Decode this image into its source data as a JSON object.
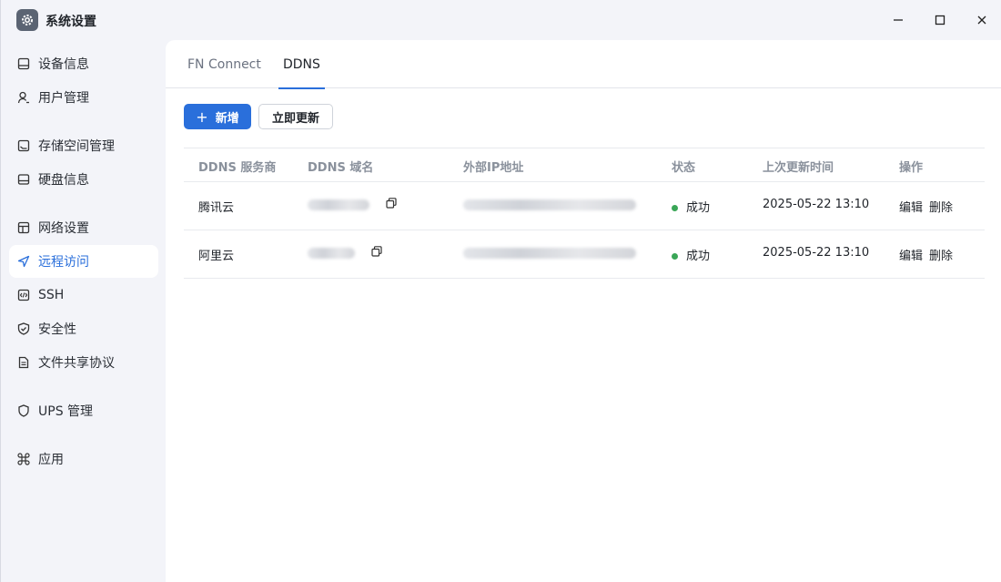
{
  "window": {
    "title": "系统设置",
    "minimize_glyph": "—",
    "maximize_glyph": "□",
    "close_glyph": "✕"
  },
  "sidebar": {
    "items": [
      {
        "label": "设备信息",
        "icon": "device-icon"
      },
      {
        "label": "用户管理",
        "icon": "user-icon"
      },
      {
        "label": "存储空间管理",
        "icon": "storage-icon"
      },
      {
        "label": "硬盘信息",
        "icon": "disk-icon"
      },
      {
        "label": "网络设置",
        "icon": "network-icon"
      },
      {
        "label": "远程访问",
        "icon": "send-icon",
        "active": true
      },
      {
        "label": "SSH",
        "icon": "code-icon"
      },
      {
        "label": "安全性",
        "icon": "shield-check-icon"
      },
      {
        "label": "文件共享协议",
        "icon": "file-icon"
      },
      {
        "label": "UPS 管理",
        "icon": "shield-icon"
      },
      {
        "label": "应用",
        "icon": "command-icon"
      }
    ]
  },
  "tabs": [
    {
      "label": "FN Connect"
    },
    {
      "label": "DDNS",
      "active": true
    }
  ],
  "toolbar": {
    "add_label": "新增",
    "add_glyph": "+",
    "refresh_label": "立即更新"
  },
  "table": {
    "columns": [
      "DDNS 服务商",
      "DDNS 域名",
      "外部IP地址",
      "状态",
      "上次更新时间",
      "操作"
    ],
    "rows": [
      {
        "provider": "腾讯云",
        "status": "成功",
        "updated": "2025-05-22 13:10",
        "edit": "编辑",
        "delete": "删除"
      },
      {
        "provider": "阿里云",
        "status": "成功",
        "updated": "2025-05-22 13:10",
        "edit": "编辑",
        "delete": "删除"
      }
    ]
  },
  "colors": {
    "accent": "#2a6fdb",
    "success": "#3aa657",
    "sidebar_bg": "#f3f4f9"
  }
}
